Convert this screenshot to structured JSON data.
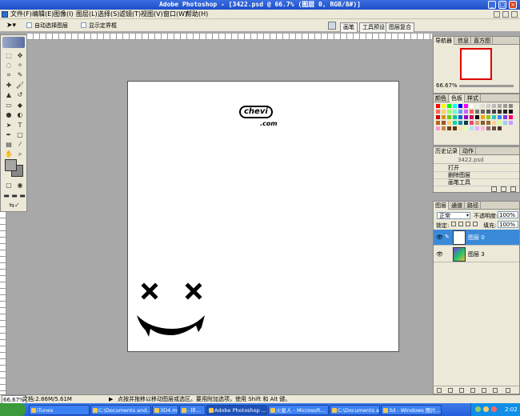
{
  "window": {
    "title": "Adobe Photoshop - [3422.psd @ 66.7% (图层 0, RGB/8#)]",
    "minimize": "_",
    "maximize": "□",
    "close": "×"
  },
  "menu": [
    "文件(F)",
    "编辑(E)",
    "图像(I)",
    "图层(L)",
    "选择(S)",
    "滤镜(T)",
    "视图(V)",
    "窗口(W)",
    "帮助(H)"
  ],
  "options": {
    "auto_select_layer": "自动选择图层",
    "show_bounds": "显示定界框",
    "workspace_tabs": [
      "画笔",
      "工具预设",
      "图层复合"
    ]
  },
  "navigator": {
    "tabs": [
      "导航器",
      "信息",
      "直方图"
    ],
    "zoom": "66.67%"
  },
  "color_panel": {
    "tabs": [
      "颜色",
      "色板",
      "样式"
    ]
  },
  "history": {
    "tabs": [
      "历史记录",
      "动作"
    ],
    "snapshot": "3422.psd",
    "items": [
      "打开",
      "删除图层",
      "画笔工具"
    ]
  },
  "layers": {
    "tabs": [
      "图层",
      "通道",
      "路径"
    ],
    "blend_mode": "正常",
    "opacity_label": "不透明度:",
    "opacity": "100%",
    "lock_label": "锁定:",
    "fill_label": "填充:",
    "fill": "100%",
    "rows": [
      {
        "name": "图层 0"
      },
      {
        "name": "图层 3"
      }
    ]
  },
  "status": {
    "zoom": "66.67%",
    "doc_size": "文档:2.86M/5.61M",
    "hint": "点按并拖移以移动图层或选区。要用附加选项，使用 Shift 和 Alt 键。"
  },
  "document": {
    "logo_top": "chevi",
    "logo_bottom": ".com"
  },
  "taskbar": {
    "items": [
      "iTunes",
      "C:\\Documents and...",
      "3D4.max",
      "- 环...",
      "Adobe Photoshop ...",
      "火星人 - Microsoft...",
      "C:\\Documents and...",
      "3d - Windows 图片..."
    ],
    "clock": "2:02"
  },
  "swatches": [
    "#ff0000",
    "#ffff00",
    "#00ff00",
    "#00ffff",
    "#0000ff",
    "#ff00ff",
    "#ffffff",
    "#eeeeee",
    "#dddddd",
    "#cccccc",
    "#bbbbbb",
    "#aaaaaa",
    "#999999",
    "#888888",
    "#ff6666",
    "#ffcc66",
    "#99ff66",
    "#66ffcc",
    "#6699ff",
    "#cc66ff",
    "#f06060",
    "#777777",
    "#666666",
    "#555555",
    "#444444",
    "#333333",
    "#222222",
    "#111111",
    "#cc0000",
    "#cc9900",
    "#66cc00",
    "#00cc99",
    "#0066cc",
    "#9900cc",
    "#cc0066",
    "#000000",
    "#f5a500",
    "#8ac926",
    "#2ec4b6",
    "#3a86ff",
    "#8338ec",
    "#ff006e",
    "#b5651d",
    "#a0522d",
    "#ffd166",
    "#06d6a0",
    "#118ab2",
    "#073b4c",
    "#ef476f",
    "#d4a373",
    "#8b5a2b",
    "#996633",
    "#ffcc99",
    "#ccff99",
    "#99ccff",
    "#cc99ff",
    "#ff99cc",
    "#c68642",
    "#704214",
    "#5c3317",
    "#ffe0b3",
    "#e0ffb3",
    "#b3e0ff",
    "#e0b3ff",
    "#ffb3e0",
    "#8d6e63",
    "#6d4c41",
    "#4e342e"
  ]
}
